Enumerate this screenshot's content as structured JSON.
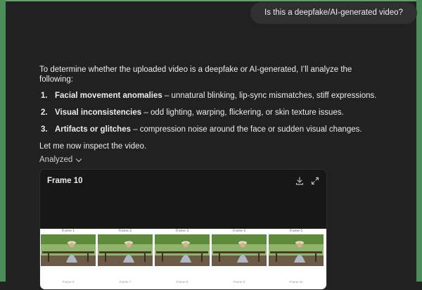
{
  "user_message": "Is this a deepfake/AI-generated video?",
  "assistant": {
    "intro": "To determine whether the uploaded video is a deepfake or AI-generated, I’ll analyze the following:",
    "steps": [
      {
        "num": "1.",
        "title": "Facial movement anomalies",
        "detail": " – unnatural blinking, lip-sync mismatches, stiff expressions."
      },
      {
        "num": "2.",
        "title": "Visual inconsistencies",
        "detail": " – odd lighting, warping, flickering, or skin texture issues."
      },
      {
        "num": "3.",
        "title": "Artifacts or glitches",
        "detail": " – compression noise around the face or sudden visual changes."
      }
    ],
    "closing": "Let me now inspect the video."
  },
  "analyzed_label": "Analyzed",
  "card": {
    "title": "Frame 10",
    "download_icon": "download-icon",
    "expand_icon": "expand-icon",
    "frames": [
      {
        "label": "Frame 1"
      },
      {
        "label": "Frame 2"
      },
      {
        "label": "Frame 3"
      },
      {
        "label": "Frame 4"
      },
      {
        "label": "Frame 5"
      }
    ],
    "second_row_labels": [
      "Frame 6",
      "Frame 7",
      "Frame 8",
      "Frame 9",
      "Frame 10"
    ]
  },
  "colors": {
    "background": "#212121",
    "bubble": "#303030",
    "card": "#171717",
    "edge_green": "#4a8f5a"
  }
}
